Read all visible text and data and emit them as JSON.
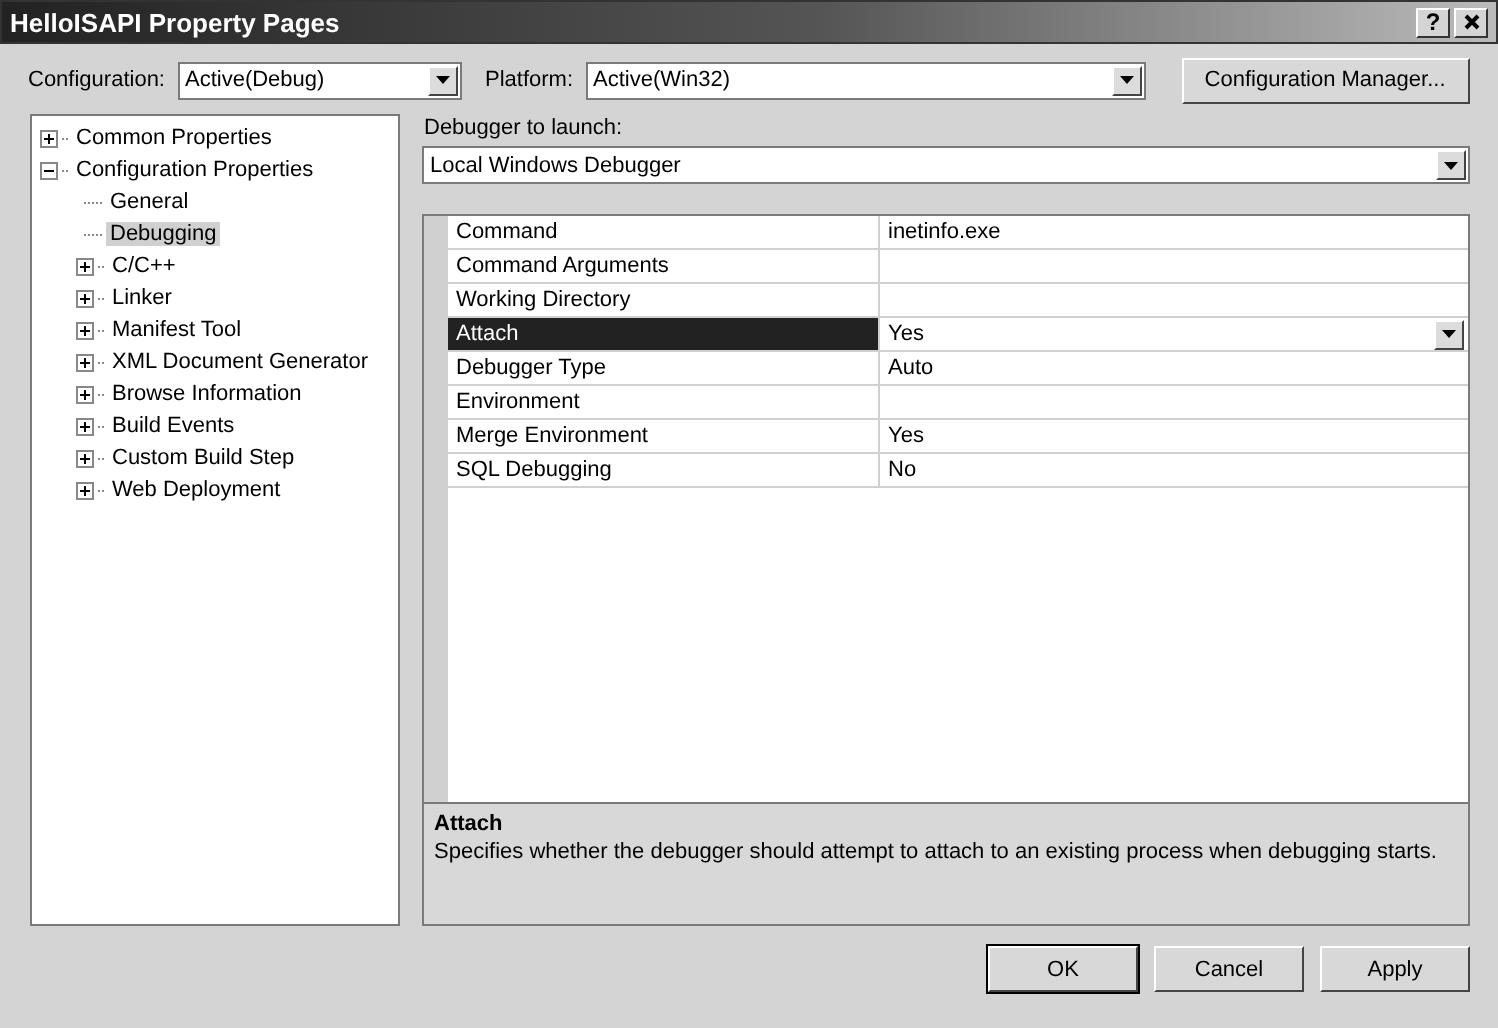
{
  "window": {
    "title": "HelloISAPI Property Pages",
    "help_button": "?"
  },
  "config_bar": {
    "configuration_label": "Configuration:",
    "configuration_value": "Active(Debug)",
    "platform_label": "Platform:",
    "platform_value": "Active(Win32)",
    "manager_button": "Configuration Manager..."
  },
  "tree": [
    {
      "label": "Common Properties",
      "expanded": false,
      "selected": false
    },
    {
      "label": "Configuration Properties",
      "expanded": true,
      "selected": false,
      "children": [
        {
          "label": "General",
          "selected": false
        },
        {
          "label": "Debugging",
          "selected": true
        },
        {
          "label": "C/C++",
          "expanded": false,
          "selected": false
        },
        {
          "label": "Linker",
          "expanded": false,
          "selected": false
        },
        {
          "label": "Manifest Tool",
          "expanded": false,
          "selected": false
        },
        {
          "label": "XML Document Generator",
          "expanded": false,
          "selected": false
        },
        {
          "label": "Browse Information",
          "expanded": false,
          "selected": false
        },
        {
          "label": "Build Events",
          "expanded": false,
          "selected": false
        },
        {
          "label": "Custom Build Step",
          "expanded": false,
          "selected": false
        },
        {
          "label": "Web Deployment",
          "expanded": false,
          "selected": false
        }
      ]
    }
  ],
  "debugger": {
    "label": "Debugger to launch:",
    "value": "Local Windows Debugger"
  },
  "properties": [
    {
      "name": "Command",
      "value": "inetinfo.exe",
      "selected": false
    },
    {
      "name": "Command Arguments",
      "selected": false
    },
    {
      "name": "Working Directory",
      "selected": false
    },
    {
      "name": "Attach",
      "value": "Yes",
      "selected": true
    },
    {
      "name": "Debugger Type",
      "value": "Auto",
      "selected": false
    },
    {
      "name": "Environment",
      "selected": false
    },
    {
      "name": "Merge Environment",
      "value": "Yes",
      "selected": false
    },
    {
      "name": "SQL Debugging",
      "value": "No",
      "selected": false
    }
  ],
  "description": {
    "title": "Attach",
    "text": "Specifies whether the debugger should attempt to attach to an existing process when debugging starts."
  },
  "buttons": [
    {
      "label": "OK",
      "kind": "default"
    },
    {
      "label": "Cancel",
      "kind": "normal"
    },
    {
      "label": "Apply",
      "kind": "normal"
    }
  ]
}
